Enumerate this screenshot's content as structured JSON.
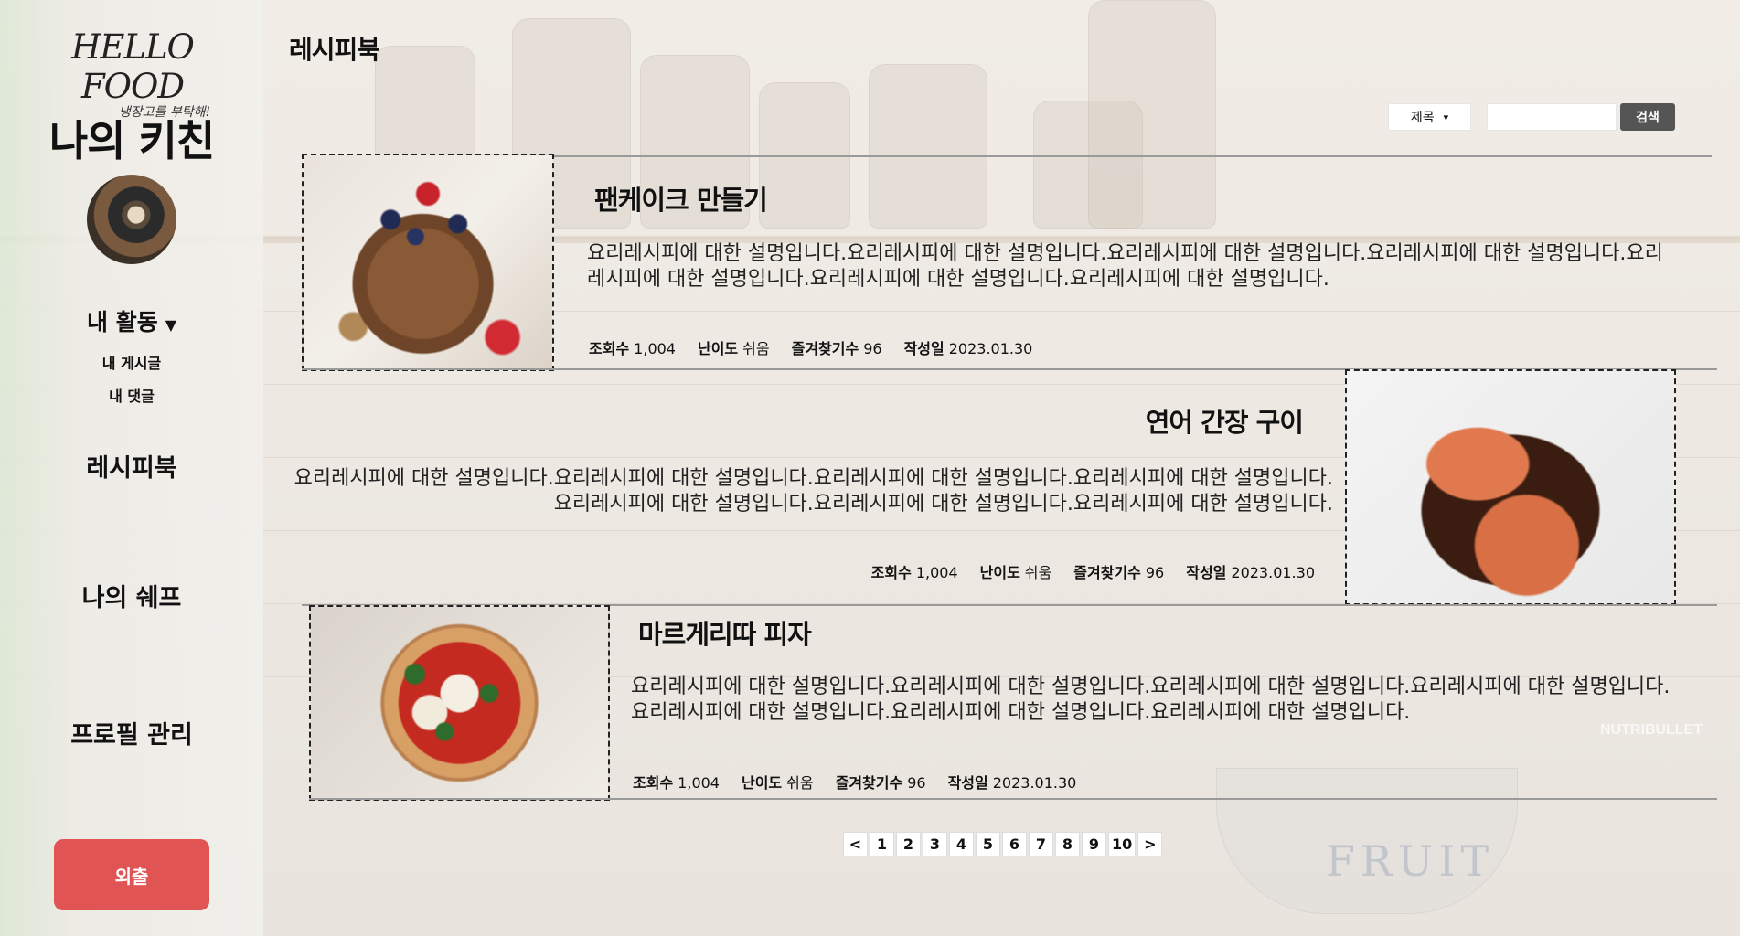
{
  "sidebar": {
    "logo_main": "HELLO FOOD",
    "logo_sub": "냉장고를 부탁해!",
    "kitchen_title": "나의 키친",
    "activity_label": "내 활동",
    "activity_caret": "▼",
    "sub_items": [
      "내 게시글",
      "내 댓글"
    ],
    "recipe_book": "레시피북",
    "my_chef": "나의 쉐프",
    "profile_manage": "프로필 관리",
    "logout": "외출"
  },
  "header": {
    "title": "레시피북"
  },
  "search": {
    "select_value": "제목",
    "select_caret": "▾",
    "input_value": "",
    "button_label": "검색"
  },
  "cards": [
    {
      "title": "팬케이크 만들기",
      "desc": "요리레시피에 대한 설명입니다.요리레시피에 대한 설명입니다.요리레시피에 대한 설명입니다.요리레시피에 대한 설명입니다.요리레시피에 대한 설명입니다.요리레시피에 대한 설명입니다.요리레시피에 대한 설명입니다.",
      "views_label": "조회수",
      "views": "1,004",
      "difficulty_label": "난이도",
      "difficulty": "쉬움",
      "bookmarks_label": "즐겨찾기수",
      "bookmarks": "96",
      "date_label": "작성일",
      "date": "2023.01.30",
      "image": "pancake-photo"
    },
    {
      "title": "연어 간장 구이",
      "desc": "요리레시피에 대한 설명입니다.요리레시피에 대한 설명입니다.요리레시피에 대한 설명입니다.요리레시피에 대한 설명입니다.요리레시피에 대한 설명입니다.요리레시피에 대한 설명입니다.요리레시피에 대한 설명입니다.",
      "views_label": "조회수",
      "views": "1,004",
      "difficulty_label": "난이도",
      "difficulty": "쉬움",
      "bookmarks_label": "즐겨찾기수",
      "bookmarks": "96",
      "date_label": "작성일",
      "date": "2023.01.30",
      "image": "salmon-photo"
    },
    {
      "title": "마르게리따 피자",
      "desc": "요리레시피에 대한 설명입니다.요리레시피에 대한 설명입니다.요리레시피에 대한 설명입니다.요리레시피에 대한 설명입니다.요리레시피에 대한 설명입니다.요리레시피에 대한 설명입니다.요리레시피에 대한 설명입니다.",
      "views_label": "조회수",
      "views": "1,004",
      "difficulty_label": "난이도",
      "difficulty": "쉬움",
      "bookmarks_label": "즐겨찾기수",
      "bookmarks": "96",
      "date_label": "작성일",
      "date": "2023.01.30",
      "image": "pizza-photo"
    }
  ],
  "pagination": {
    "prev": "<",
    "pages": [
      "1",
      "2",
      "3",
      "4",
      "5",
      "6",
      "7",
      "8",
      "9",
      "10"
    ],
    "next": ">"
  },
  "background": {
    "bowl_word": "FRUIT",
    "blender_word": "NUTRIBULLET"
  },
  "colors": {
    "logout_button": "#e05454",
    "search_button": "#555555"
  }
}
